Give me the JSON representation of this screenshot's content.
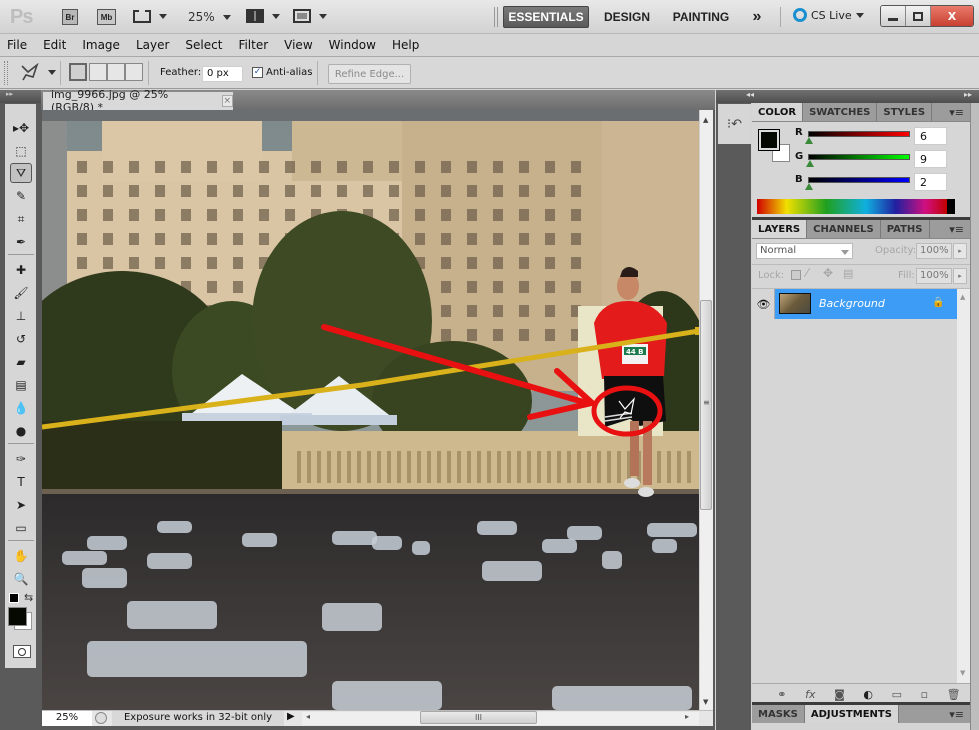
{
  "app": {
    "logo": "Ps",
    "bridge_label": "Br",
    "minibridge_label": "Mb",
    "zoom_level": "25%",
    "workspaces": [
      "ESSENTIALS",
      "DESIGN",
      "PAINTING"
    ],
    "active_workspace": "ESSENTIALS",
    "more_workspaces": "»",
    "cs_live": "CS Live",
    "window_controls": {
      "minimize": "–",
      "restore": "▢",
      "close": "X"
    }
  },
  "menu": [
    "File",
    "Edit",
    "Image",
    "Layer",
    "Select",
    "Filter",
    "View",
    "Window",
    "Help"
  ],
  "options_bar": {
    "tool_icon": "polygonal-lasso-icon",
    "feather_label": "Feather:",
    "feather_value": "0 px",
    "antialias_label": "Anti-alias",
    "antialias_checked": true,
    "refine_edge_label": "Refine Edge..."
  },
  "document": {
    "tab_title": "img_9966.jpg @ 25% (RGB/8) *",
    "close_label": "×",
    "status_zoom": "25%",
    "status_text": "Exposure works in 32-bit only",
    "scroll_grip": "III"
  },
  "tools": [
    {
      "name": "move-tool",
      "glyph": "▸✥"
    },
    {
      "name": "marquee-tool",
      "glyph": "⬚"
    },
    {
      "name": "polygonal-lasso-tool",
      "glyph": "⛛",
      "active": true
    },
    {
      "name": "quick-selection-tool",
      "glyph": "✎"
    },
    {
      "name": "crop-tool",
      "glyph": "⌗"
    },
    {
      "name": "eyedropper-tool",
      "glyph": "✒"
    },
    {
      "name": "spot-healing-tool",
      "glyph": "✚"
    },
    {
      "name": "brush-tool",
      "glyph": "🖌"
    },
    {
      "name": "clone-stamp-tool",
      "glyph": "⊥"
    },
    {
      "name": "history-brush-tool",
      "glyph": "↺"
    },
    {
      "name": "eraser-tool",
      "glyph": "▰"
    },
    {
      "name": "gradient-tool",
      "glyph": "▤"
    },
    {
      "name": "blur-tool",
      "glyph": "💧"
    },
    {
      "name": "dodge-tool",
      "glyph": "●"
    },
    {
      "name": "pen-tool",
      "glyph": "✑"
    },
    {
      "name": "type-tool",
      "glyph": "T"
    },
    {
      "name": "path-selection-tool",
      "glyph": "➤"
    },
    {
      "name": "rectangle-tool",
      "glyph": "▭"
    },
    {
      "name": "hand-tool",
      "glyph": "✋"
    },
    {
      "name": "zoom-tool",
      "glyph": "🔍"
    }
  ],
  "colors": {
    "foreground": "#060902",
    "background": "#ffffff",
    "accent": "#3d9cf5"
  },
  "color_panel": {
    "tabs": [
      "COLOR",
      "SWATCHES",
      "STYLES"
    ],
    "active_tab": "COLOR",
    "channels": [
      {
        "label": "R",
        "value": "6"
      },
      {
        "label": "G",
        "value": "9"
      },
      {
        "label": "B",
        "value": "2"
      }
    ]
  },
  "layers_panel": {
    "tabs": [
      "LAYERS",
      "CHANNELS",
      "PATHS"
    ],
    "active_tab": "LAYERS",
    "blend_mode": "Normal",
    "opacity_label": "Opacity:",
    "opacity_value": "100%",
    "lock_label": "Lock:",
    "fill_label": "Fill:",
    "fill_value": "100%",
    "layers": [
      {
        "name": "Background",
        "visible": true,
        "locked": true,
        "selected": true
      }
    ],
    "footer_icons": [
      "link-icon",
      "fx-icon",
      "mask-icon",
      "adjustment-icon",
      "folder-icon",
      "new-layer-icon",
      "trash-icon"
    ],
    "footer_glyphs": [
      "⚭",
      "fx",
      "◙",
      "◐",
      "▭",
      "▫",
      "🗑"
    ]
  },
  "bottom_panel": {
    "tabs": [
      "MASKS",
      "ADJUSTMENTS"
    ],
    "active_tab": "ADJUSTMENTS"
  },
  "canvas_annotations": {
    "bib_text": "44 B"
  }
}
